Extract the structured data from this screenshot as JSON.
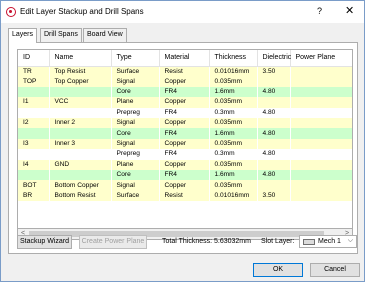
{
  "window": {
    "title": "Edit Layer Stackup and Drill Spans",
    "help_label": "?",
    "close_label": "✕"
  },
  "tabs": [
    "Layers",
    "Drill Spans",
    "Board View"
  ],
  "table": {
    "columns": [
      "ID",
      "Name",
      "Type",
      "Material",
      "Thickness",
      "Dielectric",
      "Power Plane"
    ],
    "rows": [
      {
        "color": "y",
        "cells": [
          "TR",
          "Top Resist",
          "Surface",
          "Resist",
          "0.01016mm",
          "3.50",
          ""
        ]
      },
      {
        "color": "y",
        "cells": [
          "TOP",
          "Top Copper",
          "Signal",
          "Copper",
          "0.035mm",
          "",
          ""
        ]
      },
      {
        "color": "g",
        "cells": [
          "",
          "",
          "Core",
          "FR4",
          "1.6mm",
          "4.80",
          ""
        ]
      },
      {
        "color": "y",
        "cells": [
          "I1",
          "VCC",
          "Plane",
          "Copper",
          "0.035mm",
          "",
          ""
        ]
      },
      {
        "color": "w",
        "cells": [
          "",
          "",
          "Prepreg",
          "FR4",
          "0.3mm",
          "4.80",
          ""
        ]
      },
      {
        "color": "y",
        "cells": [
          "I2",
          "Inner 2",
          "Signal",
          "Copper",
          "0.035mm",
          "",
          ""
        ]
      },
      {
        "color": "g",
        "cells": [
          "",
          "",
          "Core",
          "FR4",
          "1.6mm",
          "4.80",
          ""
        ]
      },
      {
        "color": "y",
        "cells": [
          "I3",
          "Inner 3",
          "Signal",
          "Copper",
          "0.035mm",
          "",
          ""
        ]
      },
      {
        "color": "w",
        "cells": [
          "",
          "",
          "Prepreg",
          "FR4",
          "0.3mm",
          "4.80",
          ""
        ]
      },
      {
        "color": "y",
        "cells": [
          "I4",
          "GND",
          "Plane",
          "Copper",
          "0.035mm",
          "",
          ""
        ]
      },
      {
        "color": "g",
        "cells": [
          "",
          "",
          "Core",
          "FR4",
          "1.6mm",
          "4.80",
          ""
        ]
      },
      {
        "color": "y",
        "cells": [
          "BOT",
          "Bottom Copper",
          "Signal",
          "Copper",
          "0.035mm",
          "",
          ""
        ]
      },
      {
        "color": "y",
        "cells": [
          "BR",
          "Bottom Resist",
          "Surface",
          "Resist",
          "0.01016mm",
          "3.50",
          ""
        ]
      },
      {
        "color": "w",
        "cells": [
          "",
          "",
          "",
          "",
          "",
          "",
          ""
        ]
      }
    ]
  },
  "scroll": {
    "left": "<",
    "right": ">"
  },
  "footer": {
    "stackup_wizard": "Stackup Wizard",
    "create_power_plane": "Create Power Plane",
    "total_thickness": "Total Thickness: 5.63032mm",
    "slot_layer_label": "Slot Layer:",
    "slot_layer_value": "Mech 1",
    "ok": "OK",
    "cancel": "Cancel"
  },
  "colors": {
    "row_yellow": "#ffffcc",
    "row_green": "#ccffcc",
    "focus_border": "#0078d7"
  }
}
